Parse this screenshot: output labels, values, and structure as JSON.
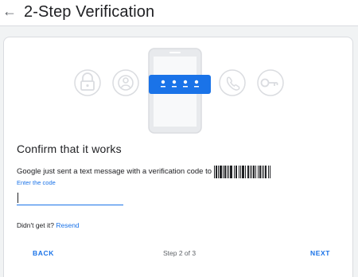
{
  "header": {
    "back_icon": "arrow-left-icon",
    "title": "2-Step Verification"
  },
  "illustration": {
    "icons": [
      "lock-icon",
      "account-icon",
      "password-dots-icon",
      "phone-icon",
      "key-icon"
    ],
    "dots": "• • • •"
  },
  "main": {
    "title": "Confirm that it works",
    "message": "Google just sent a text message with a verification code to",
    "phone_redacted": true,
    "code_label": "Enter the code",
    "code_value": "",
    "didnt_get": "Didn't get it?",
    "resend": "Resend"
  },
  "footer": {
    "back": "BACK",
    "step": "Step 2 of 3",
    "next": "NEXT"
  },
  "colors": {
    "accent": "#1a73e8",
    "illustration_gray": "#dadce0",
    "phone_screen": "#e8eaed"
  }
}
